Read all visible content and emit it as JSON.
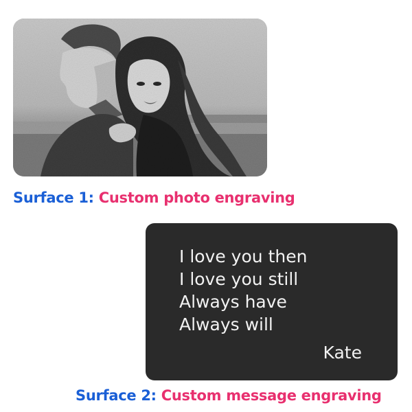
{
  "colors": {
    "surface_label": "#1a5fd6",
    "description": "#e8306f",
    "card_dark": "#2a2a2a",
    "engraving_text": "#f2f2f2"
  },
  "surface1": {
    "label": "Surface 1:",
    "description": "Custom photo engraving",
    "image": "engraved-couple-photo"
  },
  "surface2": {
    "label": "Surface 2:",
    "description": "Custom message engraving",
    "message": {
      "lines": [
        "I love you then",
        "I love you still",
        "Always have",
        "Always will"
      ],
      "signature": "Kate"
    }
  }
}
